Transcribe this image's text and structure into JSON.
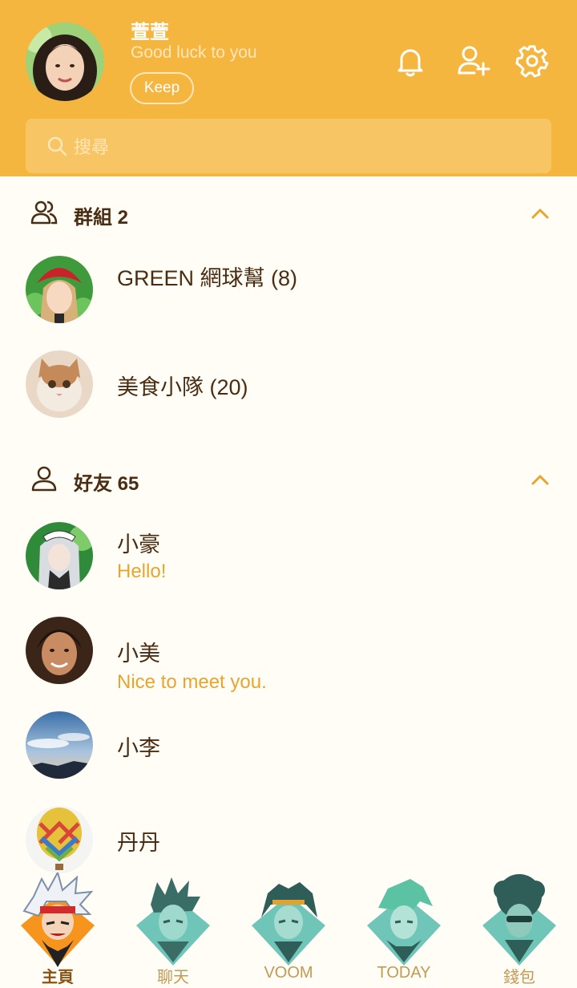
{
  "profile": {
    "name": "萱萱",
    "status": "Good luck to you",
    "keep_label": "Keep"
  },
  "header_icons": [
    "bell-icon",
    "add-friend-icon",
    "settings-gear-icon"
  ],
  "search": {
    "placeholder": "搜尋"
  },
  "groups": {
    "title": "群組 2",
    "items": [
      {
        "name": "GREEN 網球幫 (8)"
      },
      {
        "name": "美食小隊 (20)"
      }
    ]
  },
  "friends": {
    "title": "好友 65",
    "items": [
      {
        "name": "小豪",
        "message": "Hello!"
      },
      {
        "name": "小美",
        "message": "Nice to meet you."
      },
      {
        "name": "小李"
      },
      {
        "name": "丹丹"
      }
    ]
  },
  "tabs": [
    {
      "label": "主頁",
      "active": true
    },
    {
      "label": "聊天"
    },
    {
      "label": "VOOM"
    },
    {
      "label": "TODAY"
    },
    {
      "label": "錢包"
    }
  ],
  "colors": {
    "header": "#f5b640",
    "background": "#fffdf5",
    "accent": "#e8a52e",
    "text": "#4a2c12",
    "tab_diamond": "#6fc5b7"
  }
}
